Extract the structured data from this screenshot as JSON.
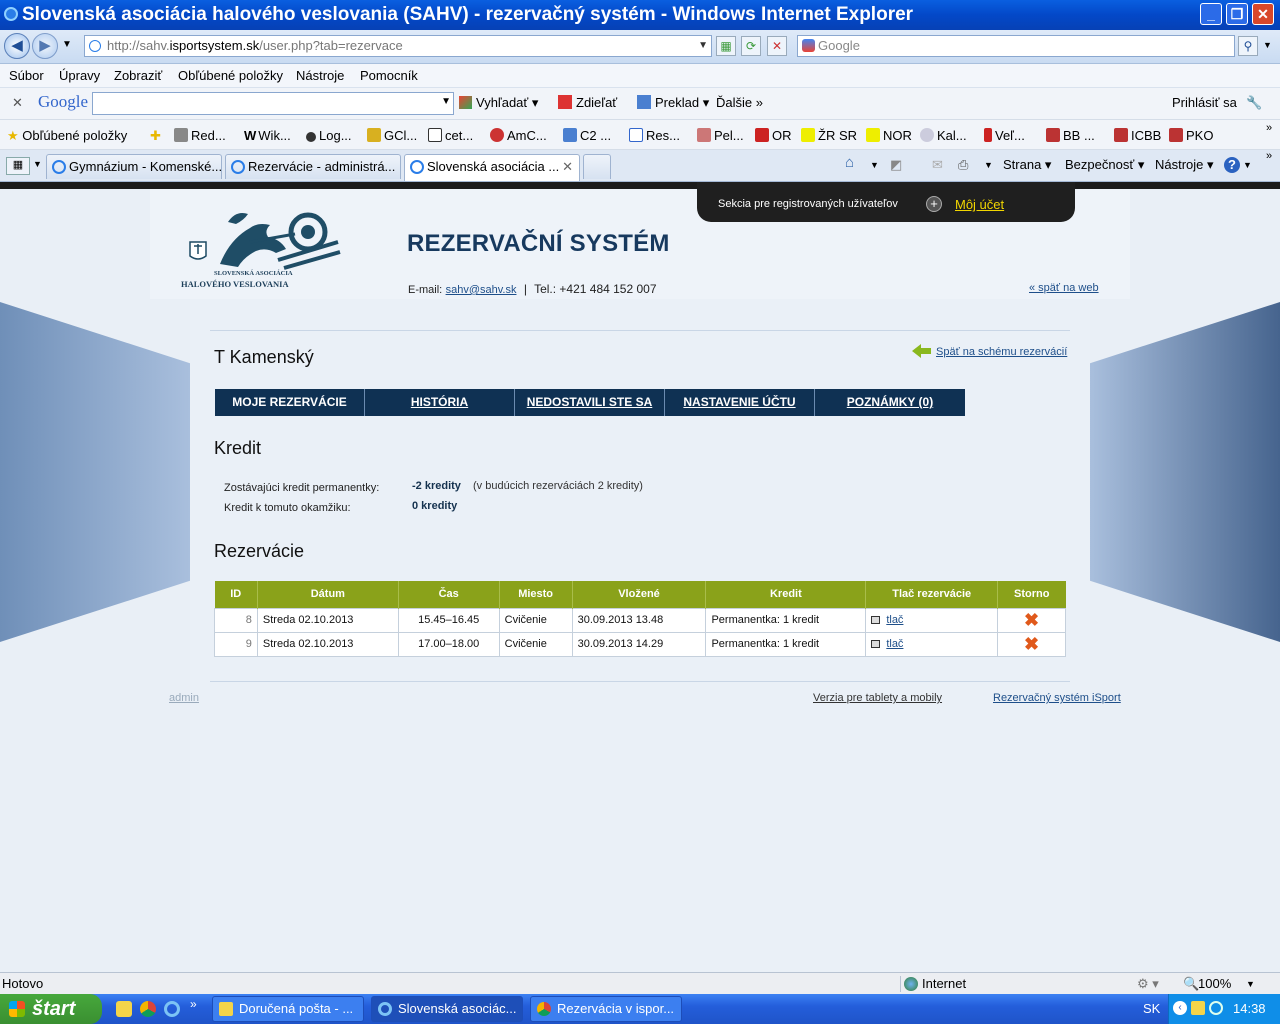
{
  "window": {
    "title": "Slovenská asociácia halového veslovania (SAHV) - rezervačný systém - Windows Internet Explorer",
    "minimize": "_",
    "maximize": "❐",
    "close": "✕"
  },
  "address_bar": {
    "url_prefix": "http://sahv.",
    "url_domain": "isportsystem.sk",
    "url_path": "/user.php?tab=rezervace",
    "search_placeholder": "Google"
  },
  "menu": [
    "Súbor",
    "Úpravy",
    "Zobraziť",
    "Obľúbené položky",
    "Nástroje",
    "Pomocník"
  ],
  "google_toolbar": {
    "logo": "Google",
    "search": "Vyhľadať",
    "share": "Zdieľať",
    "translate": "Preklad",
    "more": "Ďalšie",
    "signin": "Prihlásiť sa"
  },
  "favorites": {
    "label": "Obľúbené položky",
    "items": [
      "Red...",
      "Wik...",
      "Log...",
      "GCl...",
      "cet...",
      "AmC...",
      "C2 ...",
      "Res...",
      "Pel...",
      "OR",
      "ŽR SR",
      "NOR",
      "Kal...",
      "Veľ...",
      "BB ...",
      "ICBB",
      "PKO"
    ]
  },
  "tabs": [
    {
      "label": "Gymnázium - Komenské..."
    },
    {
      "label": "Rezervácie - administrá..."
    },
    {
      "label": "Slovenská asociácia ..."
    }
  ],
  "command_bar": {
    "page": "Strana",
    "security": "Bezpečnosť",
    "tools": "Nástroje"
  },
  "site": {
    "registered_section": "Sekcia pre registrovaných užívateľov",
    "my_account": "Môj účet",
    "logo_line1": "SLOVENSKÁ ASOCIÁCIA",
    "logo_line2": "HALOVÉHO VESLOVANIA",
    "system_title": "REZERVAČNÍ SYSTÉM",
    "email_label": "E-mail:",
    "email": "sahv@sahv.sk",
    "separator": "|",
    "phone": "Tel.: +421 484 152 007",
    "back_to_web": "« späť na web"
  },
  "user": {
    "name": "T Kamenský",
    "back_to_scheme": "Späť na schému rezervácií"
  },
  "nav_tabs": [
    "MOJE REZERVÁCIE",
    "HISTÓRIA",
    "NEDOSTAVILI STE SA",
    "NASTAVENIE ÚČTU",
    "POZNÁMKY (0)"
  ],
  "credit": {
    "heading": "Kredit",
    "remaining_label": "Zostávajúci kredit permanentky:",
    "remaining_value": "-2 kredity",
    "remaining_note": "(v budúcich rezerváciách 2 kredity)",
    "current_label": "Kredit k tomuto okamžiku:",
    "current_value": "0 kredity"
  },
  "reservations": {
    "heading": "Rezervácie",
    "columns": [
      "ID",
      "Dátum",
      "Čas",
      "Miesto",
      "Vložené",
      "Kredit",
      "Tlač rezervácie",
      "Storno"
    ],
    "rows": [
      {
        "id": "8",
        "date": "Streda 02.10.2013",
        "time": "15.45–16.45",
        "place": "Cvičenie",
        "inserted": "30.09.2013 13.48",
        "credit": "Permanentka: 1 kredit",
        "print": "tlač"
      },
      {
        "id": "9",
        "date": "Streda 02.10.2013",
        "time": "17.00–18.00",
        "place": "Cvičenie",
        "inserted": "30.09.2013 14.29",
        "credit": "Permanentka: 1 kredit",
        "print": "tlač"
      }
    ]
  },
  "footer": {
    "admin": "admin",
    "tablet": "Verzia pre tablety a mobily",
    "isport": "Rezervačný systém iSport"
  },
  "status_bar": {
    "text": "Hotovo",
    "zone": "Internet",
    "zoom": "100%"
  },
  "taskbar": {
    "start": "štart",
    "items": [
      "Doručená pošta - ...",
      "Slovenská asociác...",
      "Rezervácia v ispor..."
    ],
    "lang": "SK",
    "clock": "14:38"
  },
  "colors": {
    "nav_tab": "#0f3153",
    "table_header": "#8aa21a",
    "title_bar": "#0348c8"
  }
}
